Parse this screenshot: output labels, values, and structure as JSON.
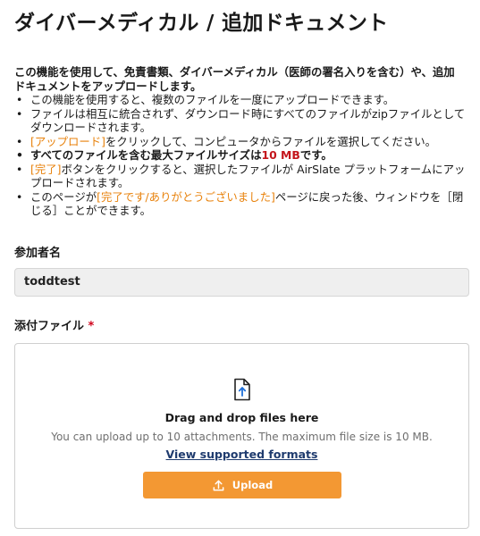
{
  "page": {
    "title": "ダイバーメディカル / 追加ドキュメント"
  },
  "instructions": {
    "intro": "この機能を使用して、免責書類、ダイバーメディカル（医師の署名入りを含む）や、追加ドキュメントをアップロードします。",
    "bullet1": "この機能を使用すると、複数のファイルを一度にアップロードできます。",
    "bullet2": "ファイルは相互に統合されず、ダウンロード時にすべてのファイルがzipファイルとしてダウンロードされます。",
    "bullet3_highlight": "[アップロード]",
    "bullet3_rest": "をクリックして、コンピュータからファイルを選択してください。",
    "bullet4_text": "すべてのファイルを含む最大ファイルサイズは",
    "bullet4_size": "10 MB",
    "bullet4_end": "です。",
    "bullet5_highlight": "[完了]",
    "bullet5_rest": "ボタンをクリックすると、選択したファイルが AirSlate プラットフォームにアップロードされます。",
    "bullet6_pre": "このページが",
    "bullet6_highlight": "[完了です/ありがとうございました]",
    "bullet6_rest": "ページに戻った後、ウィンドウを［閉じる］ことができます。"
  },
  "participant": {
    "label": "参加者名",
    "value": "toddtest"
  },
  "attachments": {
    "label": "添付ファイル",
    "required_mark": "*",
    "dropzone_title": "Drag and drop files here",
    "dropzone_hint": "You can upload up to 10 attachments.  The maximum file size is 10 MB.",
    "formats_link": "View supported formats",
    "upload_label": "Upload",
    "icon": "file-upload-icon",
    "button_color": "#f39833"
  },
  "colors": {
    "highlight": "#e8820c",
    "size_red": "#c4161c",
    "link": "#1f3b6e"
  }
}
